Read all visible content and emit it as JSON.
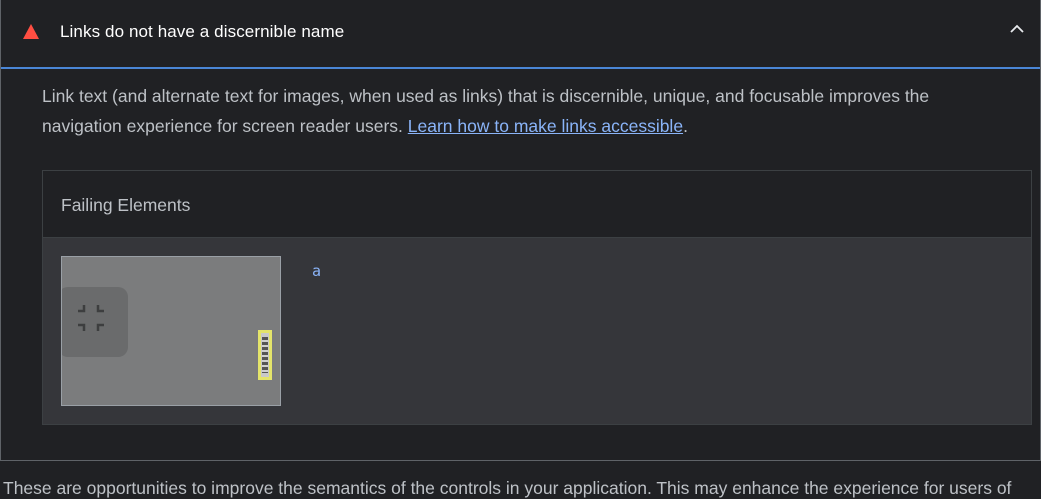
{
  "audit": {
    "title": "Links do not have a discernible name",
    "description_text": "Link text (and alternate text for images, when used as links) that is discernible, unique, and focusable improves the navigation experience for screen reader users.",
    "learn_more_link": "Learn how to make links accessible",
    "trailing_period": ".",
    "status": "fail",
    "fail_color": "#ff4e42",
    "accent_color": "#4a86d6"
  },
  "failing_elements": {
    "header": "Failing Elements",
    "items": [
      {
        "node_label": "a",
        "thumbnail_icon": "exit-fullscreen-icon"
      }
    ]
  },
  "next_section": {
    "text": "These are opportunities to improve the semantics of the controls in your application. This may enhance the experience for users of"
  }
}
